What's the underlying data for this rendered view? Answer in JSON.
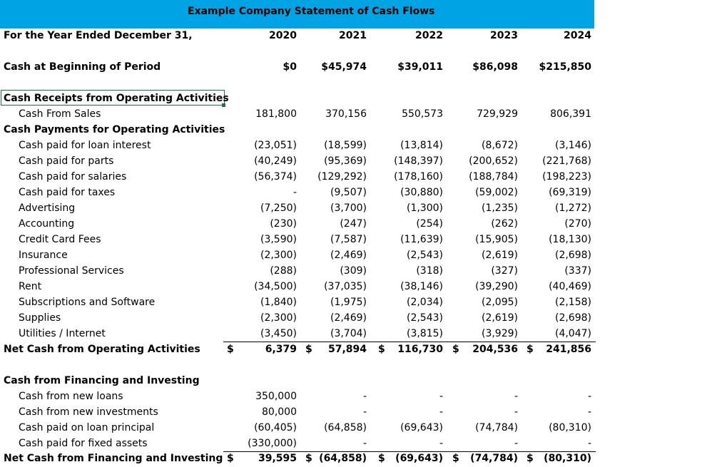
{
  "title": "Example Company Statement of Cash Flows",
  "header": {
    "label": "For the Year Ended December 31,",
    "years": [
      "2020",
      "2021",
      "2022",
      "2023",
      "2024"
    ]
  },
  "beginning": {
    "label": "Cash at Beginning of Period",
    "values": [
      "$0",
      "$45,974",
      "$39,011",
      "$86,098",
      "$215,850"
    ]
  },
  "receipts": {
    "heading": "Cash Receipts from Operating Activities",
    "rows": [
      {
        "label": "Cash From Sales",
        "values": [
          "181,800",
          "370,156",
          "550,573",
          "729,929",
          "806,391"
        ]
      }
    ]
  },
  "payments": {
    "heading": "Cash Payments for Operating Activities",
    "rows": [
      {
        "label": "Cash paid for loan interest",
        "values": [
          "(23,051)",
          "(18,599)",
          "(13,814)",
          "(8,672)",
          "(3,146)"
        ]
      },
      {
        "label": "Cash paid for parts",
        "values": [
          "(40,249)",
          "(95,369)",
          "(148,397)",
          "(200,652)",
          "(221,768)"
        ]
      },
      {
        "label": "Cash paid for salaries",
        "values": [
          "(56,374)",
          "(129,292)",
          "(178,160)",
          "(188,784)",
          "(198,223)"
        ]
      },
      {
        "label": "Cash paid for taxes",
        "values": [
          "-",
          "(9,507)",
          "(30,880)",
          "(59,002)",
          "(69,319)"
        ]
      },
      {
        "label": "Advertising",
        "values": [
          "(7,250)",
          "(3,700)",
          "(1,300)",
          "(1,235)",
          "(1,272)"
        ]
      },
      {
        "label": "Accounting",
        "values": [
          "(230)",
          "(247)",
          "(254)",
          "(262)",
          "(270)"
        ]
      },
      {
        "label": "Credit Card Fees",
        "values": [
          "(3,590)",
          "(7,587)",
          "(11,639)",
          "(15,905)",
          "(18,130)"
        ]
      },
      {
        "label": "Insurance",
        "values": [
          "(2,300)",
          "(2,469)",
          "(2,543)",
          "(2,619)",
          "(2,698)"
        ]
      },
      {
        "label": "Professional Services",
        "values": [
          "(288)",
          "(309)",
          "(318)",
          "(327)",
          "(337)"
        ]
      },
      {
        "label": "Rent",
        "values": [
          "(34,500)",
          "(37,035)",
          "(38,146)",
          "(39,290)",
          "(40,469)"
        ]
      },
      {
        "label": "Subscriptions and Software",
        "values": [
          "(1,840)",
          "(1,975)",
          "(2,034)",
          "(2,095)",
          "(2,158)"
        ]
      },
      {
        "label": "Supplies",
        "values": [
          "(2,300)",
          "(2,469)",
          "(2,543)",
          "(2,619)",
          "(2,698)"
        ]
      },
      {
        "label": "Utilities / Internet",
        "values": [
          "(3,450)",
          "(3,704)",
          "(3,815)",
          "(3,929)",
          "(4,047)"
        ]
      }
    ]
  },
  "net_operating": {
    "label": "Net Cash from Operating Activities",
    "currency": "$",
    "values": [
      "6,379",
      "57,894",
      "116,730",
      "204,536",
      "241,856"
    ]
  },
  "financing": {
    "heading": "Cash from Financing and Investing",
    "rows": [
      {
        "label": "Cash from new loans",
        "values": [
          "350,000",
          "-",
          "-",
          "-",
          "-"
        ]
      },
      {
        "label": "Cash from new investments",
        "values": [
          "80,000",
          "-",
          "-",
          "-",
          "-"
        ]
      },
      {
        "label": "Cash paid on loan principal",
        "values": [
          "(60,405)",
          "(64,858)",
          "(69,643)",
          "(74,784)",
          "(80,310)"
        ]
      },
      {
        "label": "Cash paid for fixed assets",
        "values": [
          "(330,000)",
          "-",
          "-",
          "-",
          "-"
        ]
      }
    ]
  },
  "net_financing": {
    "label": "Net Cash from Financing and Investing",
    "currency": "$",
    "values": [
      "39,595",
      "(64,858)",
      "(69,643)",
      "(74,784)",
      "(80,310)"
    ]
  }
}
